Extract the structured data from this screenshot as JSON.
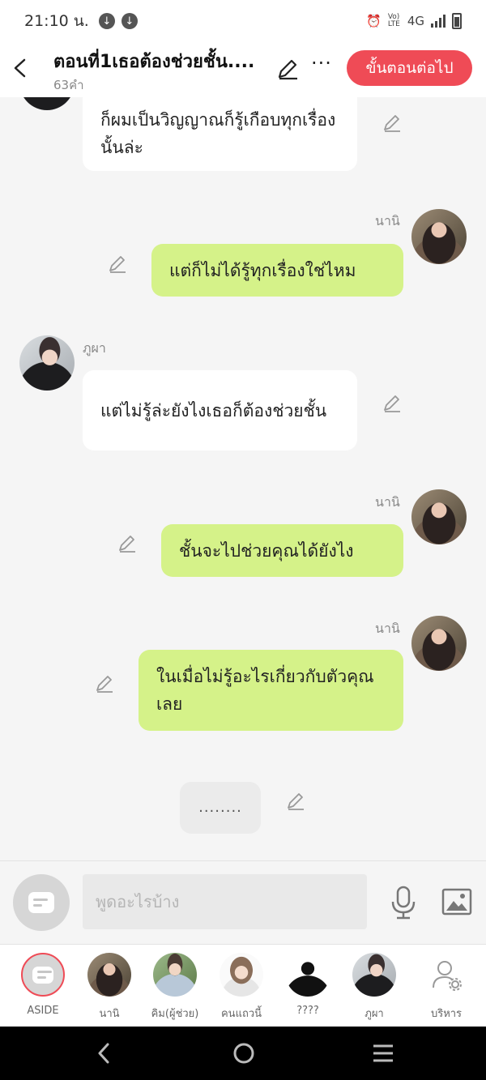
{
  "status": {
    "time": "21:10 น.",
    "network": "4G",
    "volte": "Vo) LTE"
  },
  "header": {
    "title": "ตอนที่1เธอต้องช่วยชั้น....",
    "word_count": "63คำ",
    "more": "···",
    "next_button": "ขั้นตอนต่อไป"
  },
  "messages": [
    {
      "side": "left",
      "sender": "",
      "text": "ก็ผมเป็นวิญญาณก็รู้เกือบทุกเรื่องนั้นล่ะ"
    },
    {
      "side": "right",
      "sender": "นานิ",
      "text": "แต่ก็ไม่ได้รู้ทุกเรื่องใช่ไหม"
    },
    {
      "side": "left",
      "sender": "ภูผา",
      "text": "แต่ไม่รู้ล่ะยังไงเธอก็ต้องช่วยชั้น"
    },
    {
      "side": "right",
      "sender": "นานิ",
      "text": "ชั้นจะไปช่วยคุณได้ยังไง"
    },
    {
      "side": "right",
      "sender": "นานิ",
      "text": "ในเมื่อไม่รู้อะไรเกี่ยวกับตัวคุณเลย"
    },
    {
      "side": "center",
      "sender": "",
      "text": "........"
    }
  ],
  "input": {
    "placeholder": "พูดอะไรบ้าง"
  },
  "characters": [
    {
      "label": "ASIDE",
      "icon": "chat-bubble-icon"
    },
    {
      "label": "นานิ",
      "icon": "avatar-nani"
    },
    {
      "label": "คิม(ผู้ช่วย)",
      "icon": "avatar-kim"
    },
    {
      "label": "คนแถวนี้",
      "icon": "avatar-local"
    },
    {
      "label": "????",
      "icon": "avatar-unknown"
    },
    {
      "label": "ภูผา",
      "icon": "avatar-phupha"
    },
    {
      "label": "บริหาร",
      "icon": "manage-user-icon"
    }
  ],
  "colors": {
    "accent": "#ef4b56",
    "bubble_right": "#d5f289",
    "bubble_left": "#ffffff",
    "background": "#f5f5f5"
  }
}
